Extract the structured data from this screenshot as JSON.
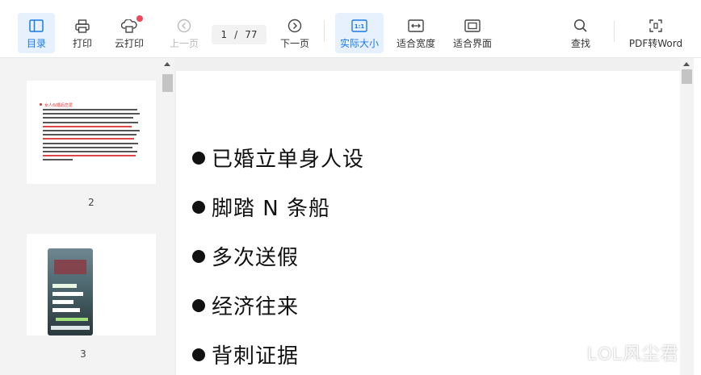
{
  "toolbar": {
    "toc_label": "目录",
    "print_label": "打印",
    "cloud_print_label": "云打印",
    "prev_label": "上一页",
    "page_current": "1",
    "page_sep": "/",
    "page_total": "77",
    "next_label": "下一页",
    "actual_size_label": "实际大小",
    "fit_width_label": "适合宽度",
    "fit_page_label": "适合界面",
    "search_label": "查找",
    "pdf_to_word_label": "PDF转Word",
    "accent_color": "#1a7ae6",
    "badge_color": "#f04a5a"
  },
  "thumbnails": [
    {
      "page": "2",
      "title": "女人似婚后恋爱"
    },
    {
      "page": "3"
    }
  ],
  "document": {
    "bullets": [
      "已婚立单身人设",
      "脚踏 N 条船",
      "多次送假",
      "经济往来",
      "背刺证据"
    ]
  },
  "watermark": "LOL风尘君"
}
